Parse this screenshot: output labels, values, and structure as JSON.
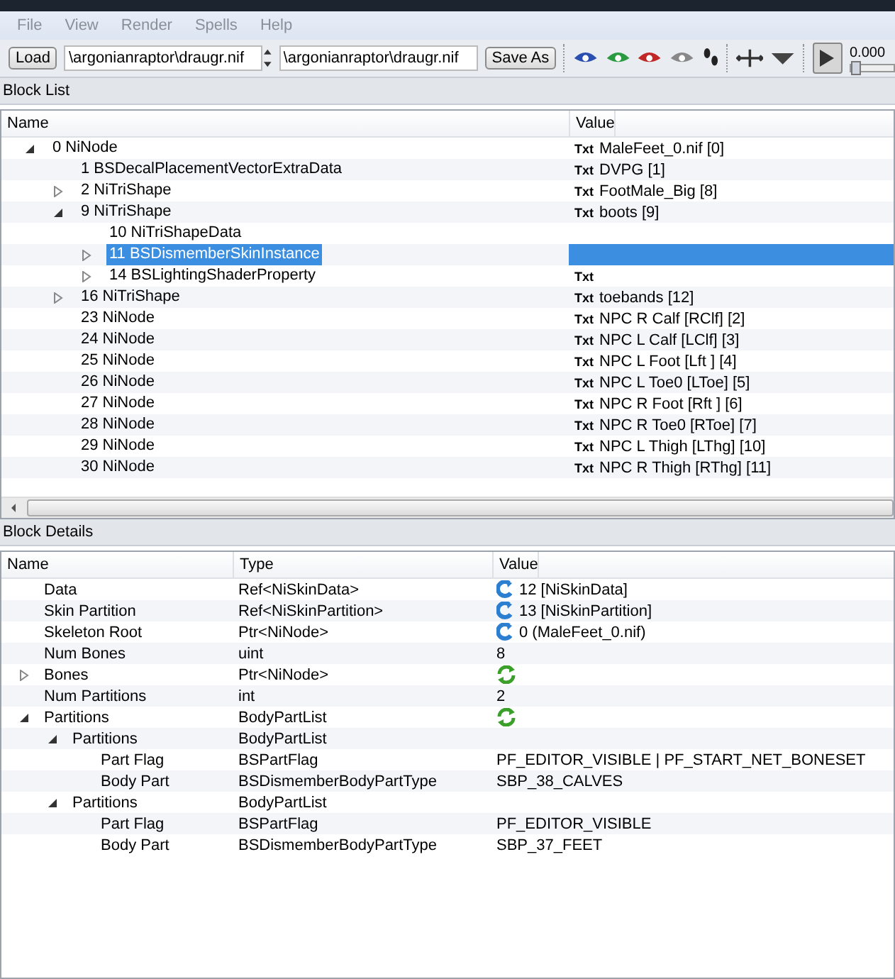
{
  "menu": [
    "File",
    "View",
    "Render",
    "Spells",
    "Help"
  ],
  "toolbar": {
    "load_button": "Load",
    "file_fields": [
      "\\argonianraptor\\draugr.nif",
      "\\argonianraptor\\draugr.nif"
    ],
    "save_button": "Save As",
    "time": "0.000",
    "time_slider": {
      "level": 0
    }
  },
  "block_list": {
    "title": "Block List",
    "columns": [
      "Name",
      "Value"
    ],
    "rows": [
      {
        "name": "0 NiNode",
        "txt": "Txt",
        "value": "MaleFeet_0.nif [0]",
        "selected": false,
        "expanded": true,
        "children": [
          {
            "name": "1 BSDecalPlacementVectorExtraData",
            "txt": "Txt",
            "value": "DVPG [1]",
            "selected": false
          },
          {
            "name": "2 NiTriShape",
            "txt": "Txt",
            "value": "FootMale_Big [8]",
            "selected": false,
            "expanded": false
          },
          {
            "name": "9 NiTriShape",
            "txt": "Txt",
            "value": "boots [9]",
            "selected": false,
            "expanded": true,
            "children": [
              {
                "name": "10 NiTriShapeData",
                "selected": false
              },
              {
                "name": "11 BSDismemberSkinInstance",
                "selected": true,
                "expanded": false
              },
              {
                "name": "14 BSLightingShaderProperty",
                "txt": "Txt",
                "selected": false,
                "expanded": false
              }
            ]
          },
          {
            "name": "16 NiTriShape",
            "txt": "Txt",
            "value": "toebands [12]",
            "selected": false,
            "expanded": false
          },
          {
            "name": "23 NiNode",
            "txt": "Txt",
            "value": "NPC R Calf [RClf] [2]",
            "selected": false
          },
          {
            "name": "24 NiNode",
            "txt": "Txt",
            "value": "NPC L Calf [LClf] [3]",
            "selected": false
          },
          {
            "name": "25 NiNode",
            "txt": "Txt",
            "value": "NPC L Foot [Lft ] [4]",
            "selected": false
          },
          {
            "name": "26 NiNode",
            "txt": "Txt",
            "value": "NPC L Toe0 [LToe] [5]",
            "selected": false
          },
          {
            "name": "27 NiNode",
            "txt": "Txt",
            "value": "NPC R Foot [Rft ] [6]",
            "selected": false
          },
          {
            "name": "28 NiNode",
            "txt": "Txt",
            "value": "NPC R Toe0 [RToe] [7]",
            "selected": false
          },
          {
            "name": "29 NiNode",
            "txt": "Txt",
            "value": "NPC L Thigh [LThg] [10]",
            "selected": false
          },
          {
            "name": "30 NiNode",
            "txt": "Txt",
            "value": "NPC R Thigh [RThg] [11]",
            "selected": false
          }
        ]
      }
    ]
  },
  "block_details": {
    "title": "Block Details",
    "columns": [
      "Name",
      "Type",
      "Value"
    ],
    "rows": [
      {
        "name": "Data",
        "type": "Ref<NiSkinData>",
        "value": "12 [NiSkinData]",
        "kind": "ref"
      },
      {
        "name": "Skin Partition",
        "type": "Ref<NiSkinPartition>",
        "value": "13 [NiSkinPartition]",
        "kind": "ref"
      },
      {
        "name": "Skeleton Root",
        "type": "Ptr<NiNode>",
        "value": "0 (MaleFeet_0.nif)",
        "kind": "ref"
      },
      {
        "name": "Num Bones",
        "type": "uint",
        "value": "8",
        "kind": "plain"
      },
      {
        "name": "Bones",
        "type": "Ptr<NiNode>",
        "kind": "array",
        "expanded": false
      },
      {
        "name": "Num Partitions",
        "type": "int",
        "value": "2",
        "kind": "plain"
      },
      {
        "name": "Partitions",
        "type": "BodyPartList",
        "kind": "array",
        "expanded": true,
        "children": [
          {
            "name": "Partitions",
            "type": "BodyPartList",
            "expanded": true,
            "children": [
              {
                "name": "Part Flag",
                "type": "BSPartFlag",
                "value": "PF_EDITOR_VISIBLE | PF_START_NET_BONESET",
                "kind": "plain"
              },
              {
                "name": "Body Part",
                "type": "BSDismemberBodyPartType",
                "value": "SBP_38_CALVES",
                "kind": "plain"
              }
            ]
          },
          {
            "name": "Partitions",
            "type": "BodyPartList",
            "expanded": true,
            "children": [
              {
                "name": "Part Flag",
                "type": "BSPartFlag",
                "value": "PF_EDITOR_VISIBLE",
                "kind": "plain"
              },
              {
                "name": "Body Part",
                "type": "BSDismemberBodyPartType",
                "value": "SBP_37_FEET",
                "kind": "plain"
              }
            ]
          }
        ]
      }
    ]
  }
}
